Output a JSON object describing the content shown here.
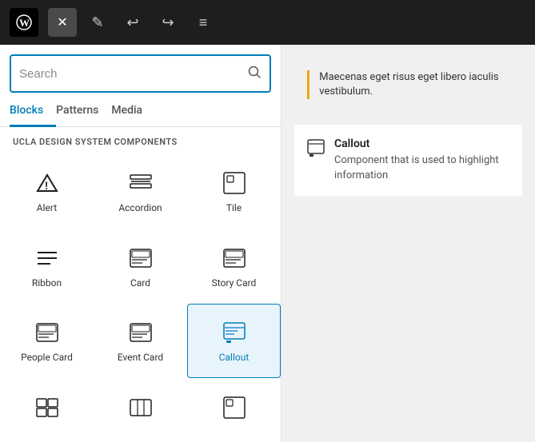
{
  "toolbar": {
    "close_label": "×",
    "undo_label": "↩",
    "redo_label": "↪",
    "list_label": "≡"
  },
  "search": {
    "placeholder": "Search",
    "value": ""
  },
  "tabs": [
    {
      "label": "Blocks",
      "active": true
    },
    {
      "label": "Patterns",
      "active": false
    },
    {
      "label": "Media",
      "active": false
    }
  ],
  "section_heading": "UCLA DESIGN SYSTEM COMPONENTS",
  "blocks": [
    {
      "label": "Alert",
      "icon": "alert",
      "selected": false
    },
    {
      "label": "Accordion",
      "icon": "accordion",
      "selected": false
    },
    {
      "label": "Tile",
      "icon": "tile",
      "selected": false
    },
    {
      "label": "Ribbon",
      "icon": "ribbon",
      "selected": false
    },
    {
      "label": "Card",
      "icon": "card",
      "selected": false
    },
    {
      "label": "Story Card",
      "icon": "storycard",
      "selected": false
    },
    {
      "label": "People Card",
      "icon": "peoplecard",
      "selected": false
    },
    {
      "label": "Event Card",
      "icon": "eventcard",
      "selected": false
    },
    {
      "label": "Callout",
      "icon": "callout",
      "selected": true
    },
    {
      "label": "",
      "icon": "grid",
      "selected": false
    },
    {
      "label": "",
      "icon": "media",
      "selected": false
    },
    {
      "label": "",
      "icon": "tile2",
      "selected": false
    }
  ],
  "callout_preview": {
    "text": "Maecenas eget risus eget libero iaculis vestibulum."
  },
  "callout_info": {
    "title": "Callout",
    "description": "Component that is used to highlight information"
  }
}
